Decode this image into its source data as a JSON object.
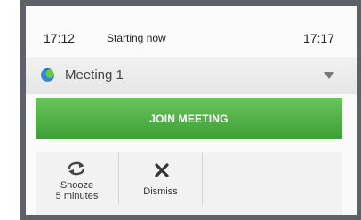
{
  "header": {
    "time_left": "17:12",
    "status": "Starting now",
    "time_right": "17:17"
  },
  "meeting": {
    "title": "Meeting 1",
    "icon": "globe-icon",
    "dropdown_icon": "chevron-down-icon"
  },
  "join": {
    "label": "JOIN MEETING",
    "color": "#4caf45"
  },
  "actions": {
    "snooze_line1": "Snooze",
    "snooze_line2": "5 minutes",
    "snooze_icon": "refresh-icon",
    "dismiss_label": "Dismiss",
    "dismiss_icon": "close-icon"
  }
}
